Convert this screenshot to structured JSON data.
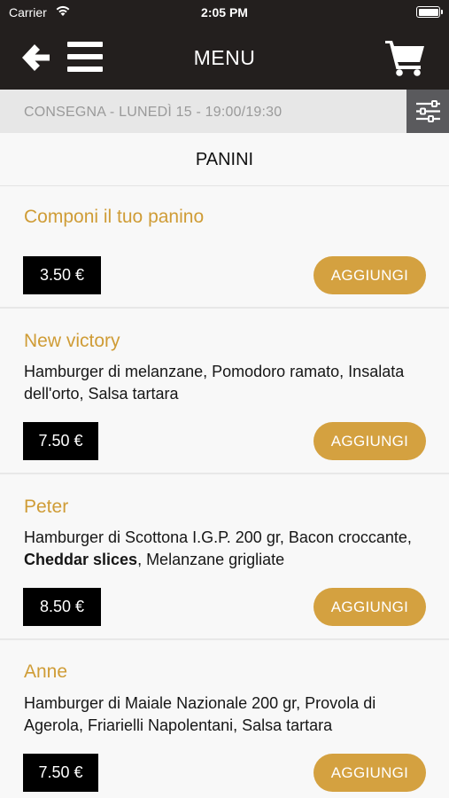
{
  "status_bar": {
    "carrier": "Carrier",
    "time": "2:05 PM"
  },
  "nav": {
    "title": "MENU"
  },
  "delivery": {
    "text": "CONSEGNA - LUNEDÌ 15 - 19:00/19:30"
  },
  "section": {
    "title": "PANINI"
  },
  "add_label": "AGGIUNGI",
  "items": [
    {
      "name": "Componi il tuo panino",
      "desc_parts": [],
      "price": "3.50 €"
    },
    {
      "name": "New victory",
      "desc_parts": [
        "Hamburger di melanzane, Pomodoro ramato, Insalata dell'orto, Salsa tartara"
      ],
      "price": "7.50 €"
    },
    {
      "name": "Peter",
      "desc_parts": [
        "Hamburger di Scottona I.G.P. 200 gr, Bacon croccante, ",
        "Cheddar slices",
        ", Melanzane grigliate"
      ],
      "price": "8.50 €"
    },
    {
      "name": "Anne",
      "desc_parts": [
        "Hamburger di Maiale Nazionale 200 gr, Provola di Agerola, Friarielli Napolentani, Salsa tartara"
      ],
      "price": "7.50 €"
    }
  ],
  "colors": {
    "header": "#231f1e",
    "accent": "#cf9c36",
    "button": "#d4a140",
    "filter_bg": "#5a5a5d"
  }
}
